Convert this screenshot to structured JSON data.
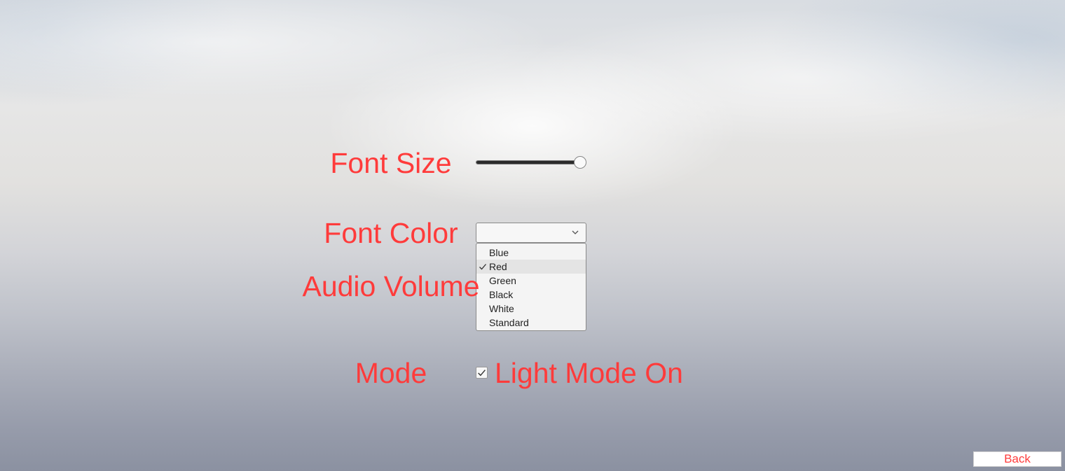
{
  "labels": {
    "font_size": "Font Size",
    "font_color": "Font Color",
    "audio_volume": "Audio Volume",
    "mode": "Mode"
  },
  "font_size_slider": {
    "value_fraction": 0.99
  },
  "font_color_dropdown": {
    "selected_value": "",
    "options": [
      {
        "label": "Blue",
        "selected": false
      },
      {
        "label": "Red",
        "selected": true
      },
      {
        "label": "Green",
        "selected": false
      },
      {
        "label": "Black",
        "selected": false
      },
      {
        "label": "White",
        "selected": false
      },
      {
        "label": "Standard",
        "selected": false
      }
    ]
  },
  "mode_toggle": {
    "label": "Light Mode On",
    "checked": true
  },
  "back_button": {
    "label": "Back"
  },
  "colors": {
    "accent_text": "#ff3b3b"
  }
}
